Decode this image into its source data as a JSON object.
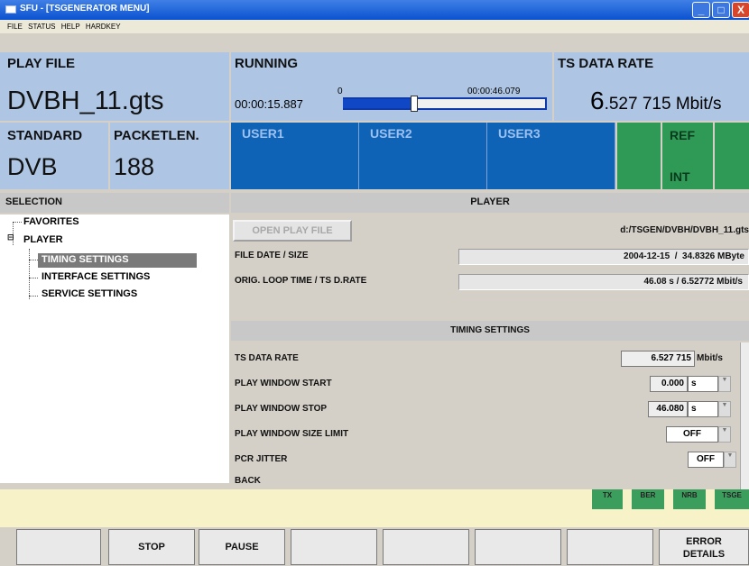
{
  "window": {
    "title": "SFU - [TSGENERATOR MENU]",
    "min_glyph": "_",
    "max_glyph": "□",
    "close_glyph": "X"
  },
  "menu": [
    "FILE",
    "STATUS",
    "HELP",
    "HARDKEY"
  ],
  "play_file": {
    "label": "PLAY FILE",
    "value": "DVBH_11.gts"
  },
  "running": {
    "label": "RUNNING",
    "elapsed": "00:00:15.887",
    "start_mark": "0",
    "total": "00:00:46.079",
    "progress_fraction": 0.345
  },
  "ts_rate": {
    "label": "TS DATA RATE",
    "value_big": "6",
    "value_rest": ".527 715 Mbit/s"
  },
  "standard": {
    "label": "STANDARD",
    "value": "DVB"
  },
  "packetlen": {
    "label": "PACKETLEN.",
    "value": "188"
  },
  "user_boxes": [
    "USER1",
    "USER2",
    "USER3"
  ],
  "ref": {
    "label": "REF",
    "value": "INT"
  },
  "selection": {
    "header": "SELECTION",
    "items": [
      "FAVORITES",
      "PLAYER",
      "TIMING SETTINGS",
      "INTERFACE SETTINGS",
      "SERVICE SETTINGS"
    ]
  },
  "player": {
    "header": "PLAYER",
    "open_button": "OPEN PLAY FILE",
    "file_path": "d:/TSGEN/DVBH/DVBH_11.gts",
    "file_date_label": "FILE DATE / SIZE",
    "file_date_value": "2004-12-15  /  34.8326 MByte",
    "loop_label": "ORIG. LOOP TIME / TS D.RATE",
    "loop_value": "46.08 s / 6.52772 Mbit/s"
  },
  "timing": {
    "header": "TIMING SETTINGS",
    "rows": [
      {
        "label": "TS DATA RATE",
        "value": "6.527 715",
        "unit": "Mbit/s"
      },
      {
        "label": "PLAY WINDOW START",
        "value": "0.000",
        "unit": "s"
      },
      {
        "label": "PLAY WINDOW STOP",
        "value": "46.080",
        "unit": "s"
      },
      {
        "label": "PLAY WINDOW SIZE LIMIT",
        "value": "OFF"
      },
      {
        "label": "PCR JITTER",
        "value": "OFF"
      },
      {
        "label": "BACK"
      }
    ]
  },
  "indicators": [
    "TX",
    "BER",
    "NRB",
    "TSGE"
  ],
  "softkeys": [
    "",
    "STOP",
    "PAUSE",
    "",
    "",
    "",
    "",
    "ERROR DETAILS"
  ],
  "colors": {
    "title_bar": "#0b52cf",
    "status_panel": "#aec6e4",
    "user_box": "#0f63b6",
    "ref_green": "#2f9a55",
    "status_bar": "#f7f2c8"
  }
}
